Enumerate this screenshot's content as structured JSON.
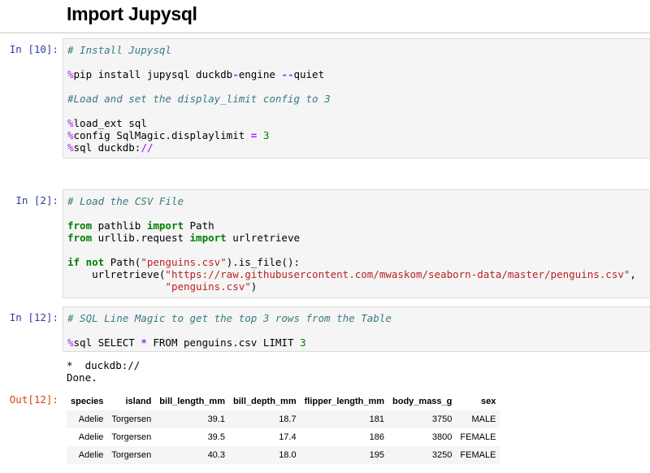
{
  "title": "Import Jupysql",
  "cells": [
    {
      "prompt": "In [10]:",
      "lines": [
        [
          [
            "cm",
            "# Install Jupysql"
          ]
        ],
        [
          [
            "mg",
            "%"
          ],
          [
            "",
            "pip install jupysql duckdb"
          ],
          [
            "op",
            "-"
          ],
          [
            "",
            "engine "
          ],
          [
            "op",
            "--"
          ],
          [
            "",
            "quiet"
          ]
        ],
        [
          [
            "cm",
            "#Load and set the display_limit config to 3"
          ]
        ],
        [
          [
            "mg",
            "%"
          ],
          [
            "",
            "load_ext sql"
          ]
        ],
        [
          [
            "mg",
            "%"
          ],
          [
            "",
            "config SqlMagic.displaylimit "
          ],
          [
            "op",
            "="
          ],
          [
            "",
            " "
          ],
          [
            "nm",
            "3"
          ]
        ],
        [
          [
            "mg",
            "%"
          ],
          [
            "",
            "sql duckdb:"
          ],
          [
            "op",
            "//"
          ]
        ]
      ]
    },
    {
      "prompt": "In [2]:",
      "lines": [
        [
          [
            "cm",
            "# Load the CSV File"
          ]
        ],
        [
          [
            "kw",
            "from"
          ],
          [
            "",
            " pathlib "
          ],
          [
            "kw",
            "import"
          ],
          [
            "",
            " Path"
          ]
        ],
        [
          [
            "kw",
            "from"
          ],
          [
            "",
            " urllib.request "
          ],
          [
            "kw",
            "import"
          ],
          [
            "",
            " urlretrieve"
          ]
        ],
        [
          [
            "kw",
            "if"
          ],
          [
            "",
            " "
          ],
          [
            "kw",
            "not"
          ],
          [
            "",
            " Path("
          ],
          [
            "st",
            "\"penguins.csv\""
          ],
          [
            "",
            ").is_file():"
          ]
        ],
        [
          [
            "",
            "    urlretrieve("
          ],
          [
            "st",
            "\"https://raw.githubusercontent.com/mwaskom/seaborn-data/master/penguins.csv\""
          ],
          [
            "",
            ","
          ]
        ],
        [
          [
            "",
            "                "
          ],
          [
            "st",
            "\"penguins.csv\""
          ],
          [
            "",
            ")"
          ]
        ]
      ]
    },
    {
      "prompt": "In [12]:",
      "lines": [
        [
          [
            "cm",
            "# SQL Line Magic to get the top 3 rows from the Table"
          ]
        ],
        [
          [
            "mg",
            "%"
          ],
          [
            "",
            "sql SELECT "
          ],
          [
            "op",
            "*"
          ],
          [
            "",
            " FROM penguins.csv LIMIT "
          ],
          [
            "nm",
            "3"
          ]
        ]
      ]
    }
  ],
  "stdout": [
    "*  duckdb://",
    "Done."
  ],
  "out_prompt": "Out[12]:",
  "table": {
    "columns": [
      "species",
      "island",
      "bill_length_mm",
      "bill_depth_mm",
      "flipper_length_mm",
      "body_mass_g",
      "sex"
    ],
    "rows": [
      [
        "Adelie",
        "Torgersen",
        "39.1",
        "18.7",
        "181",
        "3750",
        "MALE"
      ],
      [
        "Adelie",
        "Torgersen",
        "39.5",
        "17.4",
        "186",
        "3800",
        "FEMALE"
      ],
      [
        "Adelie",
        "Torgersen",
        "40.3",
        "18.0",
        "195",
        "3250",
        "FEMALE"
      ]
    ]
  }
}
